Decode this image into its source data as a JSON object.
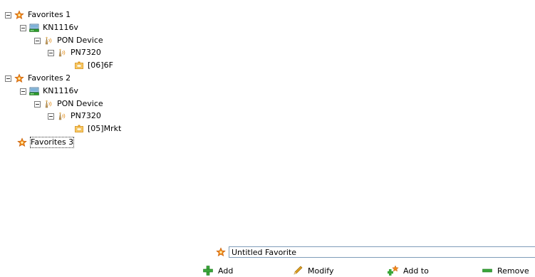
{
  "tree": [
    {
      "label": "Favorites 1",
      "icon": "star-icon"
    },
    {
      "label": "KN1116v",
      "icon": "network-switch-icon"
    },
    {
      "label": "PON Device",
      "icon": "pon-device-icon"
    },
    {
      "label": "PN7320",
      "icon": "pon-device-icon"
    },
    {
      "label": "[06]6F",
      "icon": "onu-port-icon"
    },
    {
      "label": "Favorites 2",
      "icon": "star-icon"
    },
    {
      "label": "KN1116v",
      "icon": "network-switch-icon"
    },
    {
      "label": "PON Device",
      "icon": "pon-device-icon"
    },
    {
      "label": "PN7320",
      "icon": "pon-device-icon"
    },
    {
      "label": "[05]Mrkt",
      "icon": "onu-port-icon"
    },
    {
      "label": "Favorites 3",
      "icon": "star-icon"
    }
  ],
  "favorite_name": {
    "value": "Untitled Favorite"
  },
  "actions": {
    "add": "Add",
    "modify": "Modify",
    "add_to": "Add to",
    "remove": "Remove"
  },
  "colors": {
    "star": "#f08a1c",
    "switch_green": "#2e9b2e",
    "add_green": "#3aa63a",
    "pencil": "#e0a020"
  }
}
